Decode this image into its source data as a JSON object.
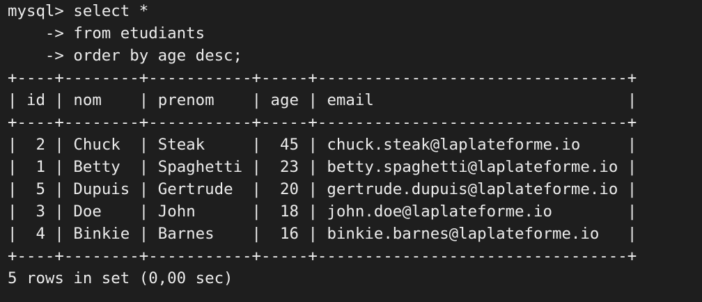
{
  "prompt": "mysql>",
  "query_lines": [
    "select *",
    "-> from etudiants",
    "-> order by age desc;"
  ],
  "table": {
    "columns": [
      "id",
      "nom",
      "prenom",
      "age",
      "email"
    ],
    "rows": [
      [
        "2",
        "Chuck",
        "Steak",
        "45",
        "chuck.steak@laplateforme.io"
      ],
      [
        "1",
        "Betty",
        "Spaghetti",
        "23",
        "betty.spaghetti@laplateforme.io"
      ],
      [
        "5",
        "Dupuis",
        "Gertrude",
        "20",
        "gertrude.dupuis@laplateforme.io"
      ],
      [
        "3",
        "Doe",
        "John",
        "18",
        "john.doe@laplateforme.io"
      ],
      [
        "4",
        "Binkie",
        "Barnes",
        "16",
        "binkie.barnes@laplateforme.io"
      ]
    ]
  },
  "result_summary": "5 rows in set (0,00 sec)"
}
